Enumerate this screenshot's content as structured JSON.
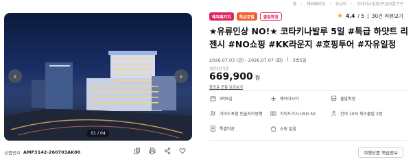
{
  "breadcrumb": [
    "홈",
    "해외패키지",
    "동남아",
    "코타키나발루/쿠알라룸프르"
  ],
  "gallery": {
    "counter_current": "01",
    "counter_sep": "/",
    "counter_total": "04"
  },
  "product_code": {
    "label": "상품번호",
    "value": "AMP3142-260703AK00"
  },
  "tags": [
    "해외패키지",
    "특급호텔",
    "출발확정"
  ],
  "rating": {
    "score": "4.4",
    "max": "/ 5",
    "reviews": "30건 리뷰보기"
  },
  "title": "★유류인상 NO!★ 코타키나발루 5일 #특급 하얏트 리젠시 #NO쇼핑 #KK라운지 #호핑투어 #자유일정",
  "dates": {
    "range": "2026.07.03 (금) - 2026.07.07 (화)",
    "duration": "3박5일"
  },
  "price": {
    "label": "성인1인기준",
    "amount": "669,900",
    "unit": "원",
    "link": "항공료 포함 요금보기"
  },
  "info": [
    {
      "icon": "calendar-icon",
      "text": "3박5일"
    },
    {
      "icon": "plane-icon",
      "text": "에어아시아"
    },
    {
      "icon": "bus-icon",
      "text": "출발확정"
    },
    {
      "icon": "guide-icon",
      "text": "가이드포함 인솔자미동행"
    },
    {
      "icon": "money-icon",
      "text": "가이드기사 USD 50"
    },
    {
      "icon": "person-icon",
      "text": "잔여 10석 최소출발 2명"
    },
    {
      "icon": "contract-icon",
      "text": "특별약관"
    },
    {
      "icon": "shopping-icon",
      "text": "쇼핑 없음"
    }
  ],
  "core_button": "여행상품 핵심정보"
}
